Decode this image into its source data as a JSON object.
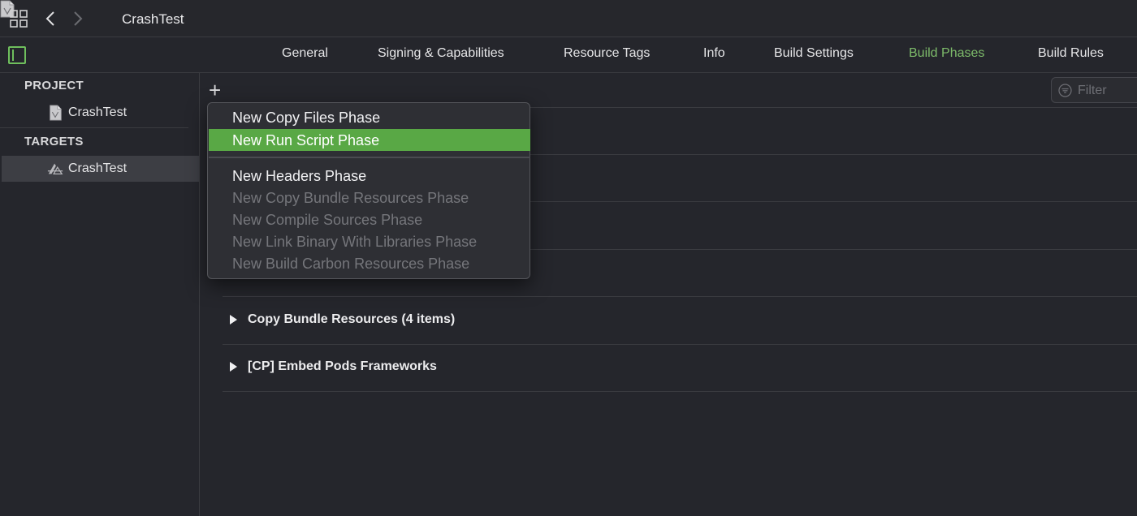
{
  "titlebar": {
    "project_name": "CrashTest",
    "icons": [
      "grid-icon",
      "back-chevron-icon",
      "forward-chevron-icon",
      "project-file-icon"
    ]
  },
  "tabs": [
    {
      "label": "General",
      "active": false
    },
    {
      "label": "Signing & Capabilities",
      "active": false
    },
    {
      "label": "Resource Tags",
      "active": false
    },
    {
      "label": "Info",
      "active": false
    },
    {
      "label": "Build Settings",
      "active": false
    },
    {
      "label": "Build Phases",
      "active": true
    },
    {
      "label": "Build Rules",
      "active": false
    }
  ],
  "sidebar": {
    "project_header": "PROJECT",
    "project_item": "CrashTest",
    "targets_header": "TARGETS",
    "target_item": "CrashTest"
  },
  "main": {
    "add_symbol": "+",
    "filter_placeholder": "Filter",
    "phases": [
      {
        "title": "Copy Bundle Resources (4 items)"
      },
      {
        "title": "[CP] Embed Pods Frameworks"
      }
    ]
  },
  "menu": {
    "items": [
      {
        "label": "New Copy Files Phase",
        "state": "enabled"
      },
      {
        "label": "New Run Script Phase",
        "state": "highlighted"
      },
      {
        "label": "New Headers Phase",
        "state": "enabled"
      },
      {
        "label": "New Copy Bundle Resources Phase",
        "state": "disabled"
      },
      {
        "label": "New Compile Sources Phase",
        "state": "disabled"
      },
      {
        "label": "New Link Binary With Libraries Phase",
        "state": "disabled"
      },
      {
        "label": "New Build Carbon Resources Phase",
        "state": "disabled"
      }
    ]
  },
  "colors": {
    "accent_green": "#59a845",
    "active_tab": "#7dbb6a",
    "background": "#25262c"
  }
}
